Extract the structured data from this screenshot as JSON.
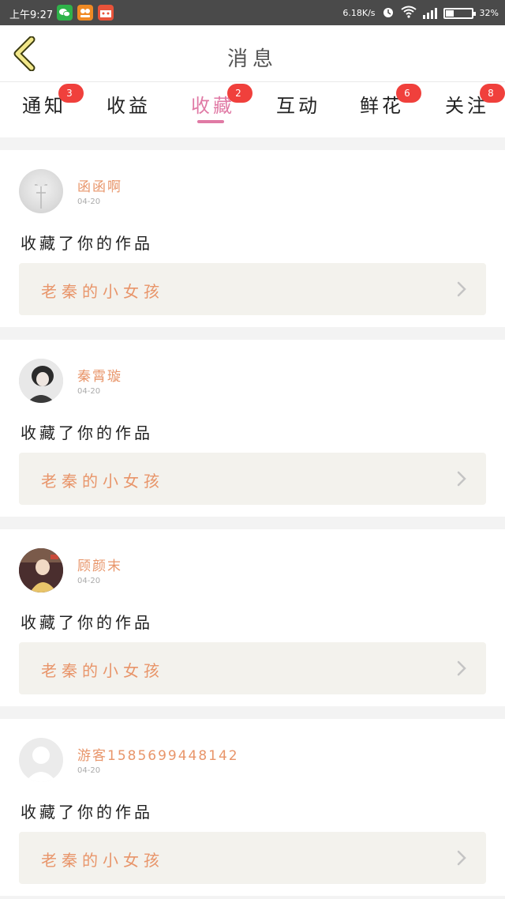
{
  "status_bar": {
    "time": "上午9:27",
    "network_speed": "6.18K/s",
    "battery": "32%",
    "battery_level": 0.32
  },
  "header": {
    "title": "消息",
    "back_icon": "chevron-left-icon"
  },
  "tabs": [
    {
      "label": "通知",
      "badge": "3",
      "active": false
    },
    {
      "label": "收益",
      "badge": "",
      "active": false
    },
    {
      "label": "收藏",
      "badge": "2",
      "active": true
    },
    {
      "label": "互动",
      "badge": "",
      "active": false
    },
    {
      "label": "鲜花",
      "badge": "6",
      "active": false
    },
    {
      "label": "关注",
      "badge": "8",
      "active": false
    }
  ],
  "messages": [
    {
      "user": "函函啊",
      "date": "04-20",
      "action": "收藏了你的作品",
      "work_title": "老秦的小女孩"
    },
    {
      "user": "秦霄璇",
      "date": "04-20",
      "action": "收藏了你的作品",
      "work_title": "老秦的小女孩"
    },
    {
      "user": "顾颜末",
      "date": "04-20",
      "action": "收藏了你的作品",
      "work_title": "老秦的小女孩"
    },
    {
      "user": "游客15856994481​42",
      "date": "04-20",
      "action": "收藏了你的作品",
      "work_title": "老秦的小女孩"
    }
  ],
  "colors": {
    "accent": "#e07aa5",
    "badge": "#f0403c",
    "username": "#e8956a",
    "work_bg": "#f3f2ed"
  }
}
